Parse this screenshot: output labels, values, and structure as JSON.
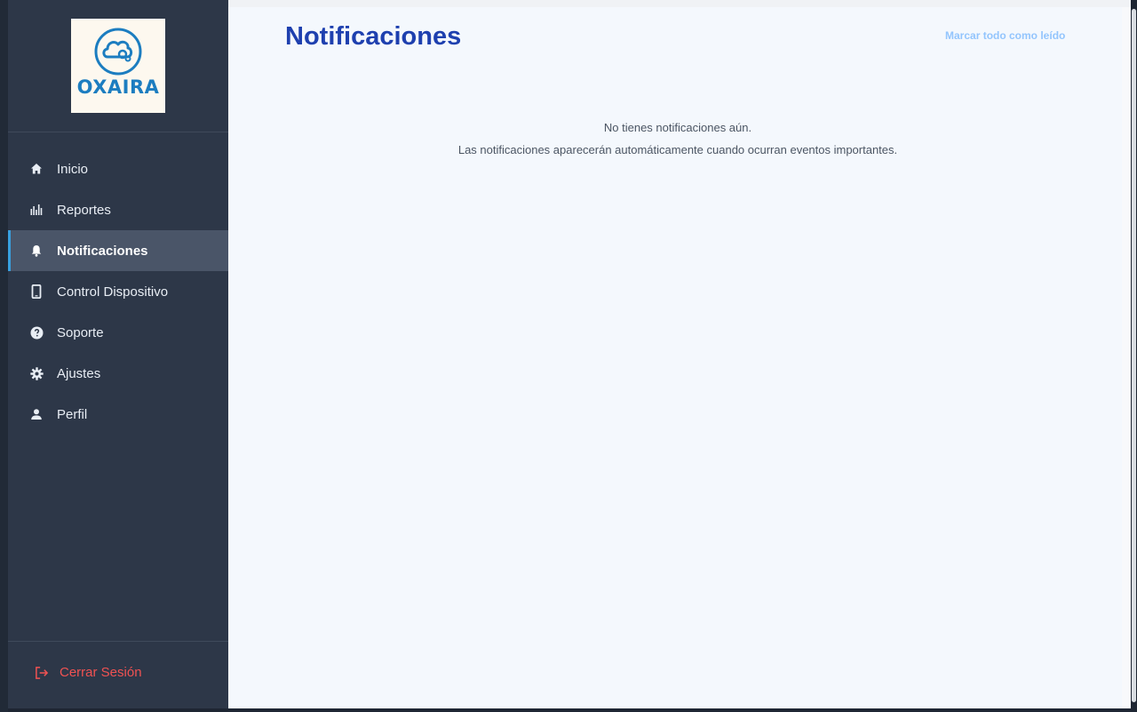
{
  "brand": {
    "logo_text": "OXAIRA",
    "logo_color": "#1c7dc0"
  },
  "sidebar": {
    "items": [
      {
        "label": "Inicio",
        "icon": "home-icon",
        "active": false
      },
      {
        "label": "Reportes",
        "icon": "bar-chart-icon",
        "active": false
      },
      {
        "label": "Notificaciones",
        "icon": "bell-icon",
        "active": true
      },
      {
        "label": "Control Dispositivo",
        "icon": "phone-icon",
        "active": false
      },
      {
        "label": "Soporte",
        "icon": "help-icon",
        "active": false
      },
      {
        "label": "Ajustes",
        "icon": "gear-icon",
        "active": false
      },
      {
        "label": "Perfil",
        "icon": "user-icon",
        "active": false
      }
    ],
    "logout_label": "Cerrar Sesión",
    "logout_icon": "logout-icon"
  },
  "main": {
    "title": "Notificaciones",
    "mark_all_label": "Marcar todo como leído",
    "empty_title": "No tienes notificaciones aún.",
    "empty_subtitle": "Las notificaciones aparecerán automáticamente cuando ocurran eventos importantes."
  },
  "colors": {
    "sidebar_bg": "#2d3748",
    "active_bg": "#4a5568",
    "accent": "#1e40af",
    "logout": "#f05252"
  }
}
